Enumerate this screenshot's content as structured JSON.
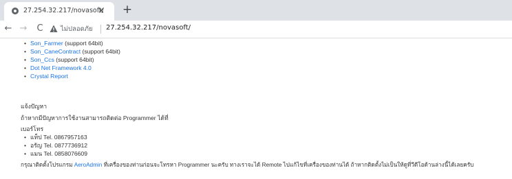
{
  "browser": {
    "tab_title": "27.254.32.217/novasoft/",
    "tab_close": "×",
    "new_tab": "+",
    "back": "←",
    "forward": "→",
    "reload": "C",
    "security_label": "ไม่ปลอดภัย",
    "url": "27.254.32.217/novasoft/",
    "favicon_icon": "globe-icon",
    "warning_icon": "warning-icon"
  },
  "downloads": [
    {
      "link": "Son_Farmer",
      "note": " (support 64bit)"
    },
    {
      "link": "Son_CaneContract",
      "note": " (support 64bit)"
    },
    {
      "link": "Son_Ccs",
      "note": " (support 64bit)"
    },
    {
      "link": "Dot Net Framework 4.0",
      "note": ""
    },
    {
      "link": "Crystal Report",
      "note": ""
    }
  ],
  "contact": {
    "heading": "แจ้งปัญหา",
    "intro": "ถ้าหากมีปัญหาการใช้งานสามารถติดต่อ Programmer ได้ที่",
    "phone_heading": "เบอร์โทร",
    "phones": [
      "แท็ป  Tel. 0867957163",
      "อรัญ  Tel. 0877736912",
      "แมน  Tel. 0858076609"
    ],
    "note_before": "กรุณาติดตั้งโปรแกรม ",
    "note_link": "AeroAdmin",
    "note_after": " ที่เครื่องของท่านก่อนจะโทรหา Programmer นะครับ ทางเราจะได้ Remote ไปแก้ไขที่เครื่องของท่านได้ ถ้าหากติดตั้งไม่เป็นให้ดูที่วีดีโอด้านล่างนี้ได้เลยครับ"
  }
}
